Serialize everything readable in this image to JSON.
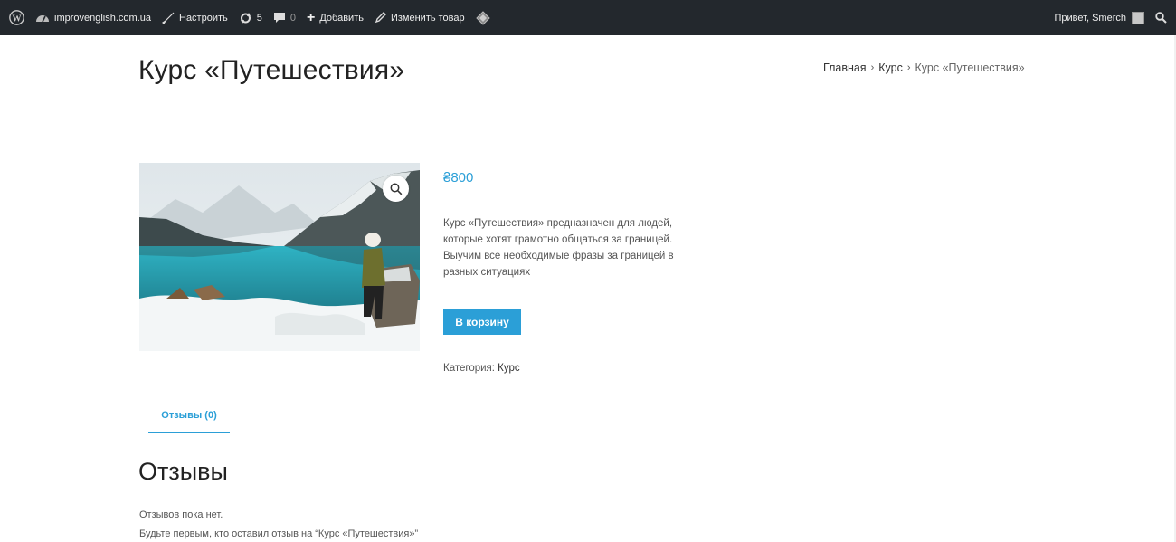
{
  "adminbar": {
    "site_name": "improvenglish.com.ua",
    "customize": "Настроить",
    "updates_count": "5",
    "comments_count": "0",
    "add_new": "Добавить",
    "edit_product": "Изменить товар",
    "greeting": "Привет, Smerch"
  },
  "page": {
    "title": "Курс «Путешествия»"
  },
  "breadcrumb": {
    "home": "Главная",
    "sep1": "›",
    "category": "Курс",
    "sep2": "›",
    "current": "Курс «Путешествия»"
  },
  "product": {
    "price": "₴800",
    "description": "Курс «Путешествия» предназначен для людей, которые хотят грамотно общаться за границей. Выучим все необходимые фразы за границей в разных ситуациях",
    "add_to_cart": "В корзину",
    "category_label": "Категория:",
    "category_value": "Курс"
  },
  "tabs": {
    "reviews_tab": "Отзывы (0)"
  },
  "reviews": {
    "title": "Отзывы",
    "none": "Отзывов пока нет.",
    "be_first": "Будьте первым, кто оставил отзыв на “Курс «Путешествия»”"
  },
  "colors": {
    "adminbar_bg": "#23282d",
    "accent": "#2b9fd7"
  }
}
